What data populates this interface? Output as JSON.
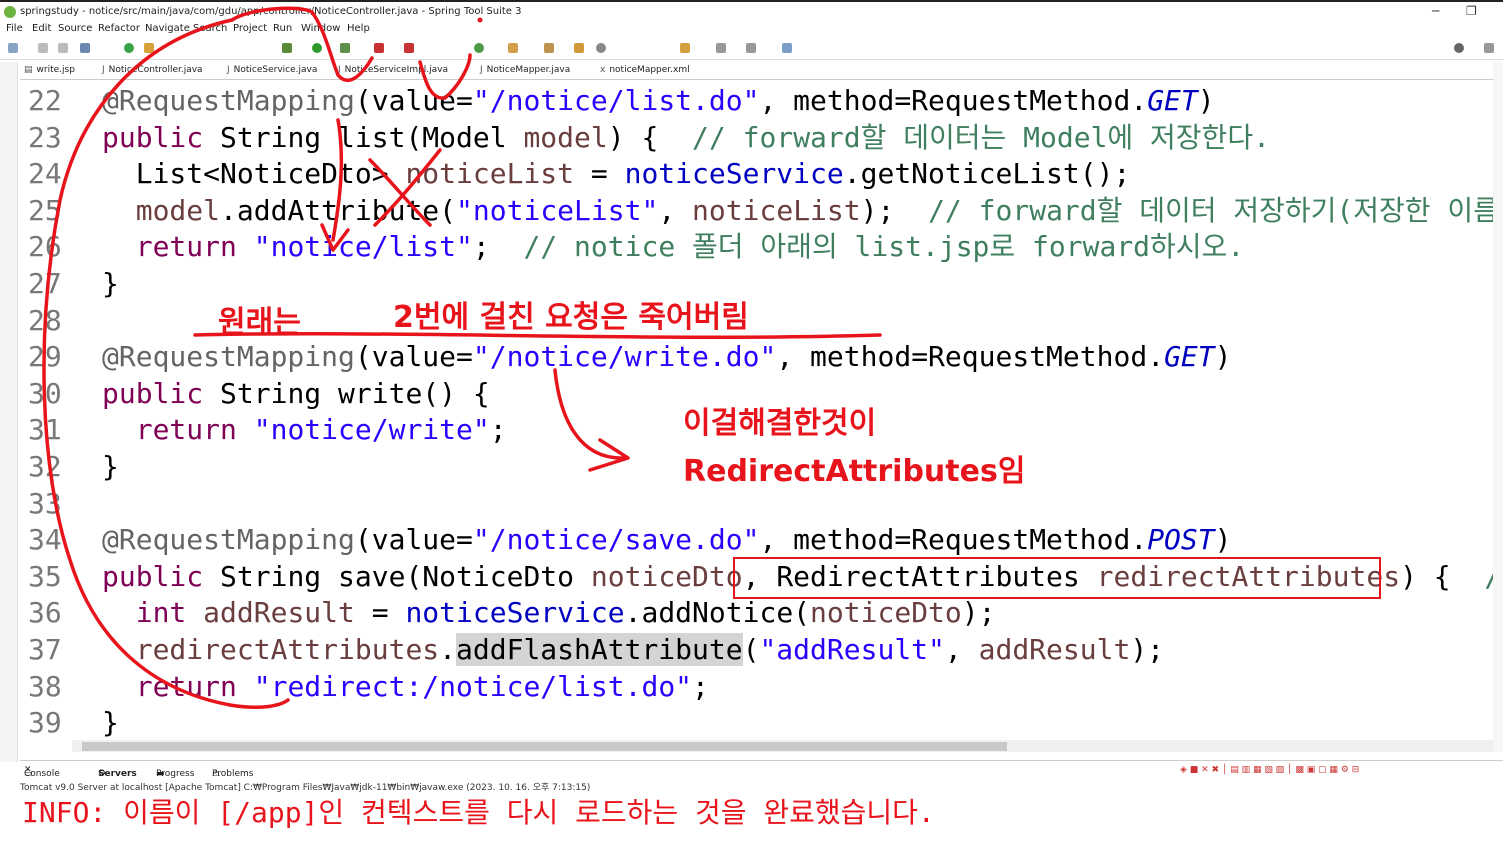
{
  "window": {
    "title": "springstudy - notice/src/main/java/com/gdu/app/controller/NoticeController.java - Spring Tool Suite 3",
    "minimize": "─",
    "restore": "❐"
  },
  "menu": [
    "File",
    "Edit",
    "Source",
    "Refactor",
    "Navigate",
    "Search",
    "Project",
    "Run",
    "Window",
    "Help"
  ],
  "tabs": [
    "write.jsp",
    "NoticeController.java",
    "NoticeService.java",
    "NoticeServiceImpl.java",
    "NoticeMapper.java",
    "noticeMapper.xml"
  ],
  "code": {
    "lines": [
      {
        "n": "22",
        "t": [
          [
            "ann",
            "@RequestMapping"
          ],
          [
            "p",
            "("
          ],
          [
            "p",
            "value="
          ],
          [
            "str",
            "\"/notice/list.do\""
          ],
          [
            "p",
            ", method=RequestMethod."
          ],
          [
            "it",
            "GET"
          ],
          [
            "p",
            ")"
          ]
        ]
      },
      {
        "n": "23",
        "t": [
          [
            "kw",
            "public"
          ],
          [
            "p",
            " String list(Model "
          ],
          [
            "par",
            "model"
          ],
          [
            "p",
            ") {  "
          ],
          [
            "cm",
            "// forward할 데이터는 Model에 저장한다."
          ]
        ]
      },
      {
        "n": "24",
        "t": [
          [
            "p",
            "  List<NoticeDto> "
          ],
          [
            "par",
            "noticeList"
          ],
          [
            "p",
            " = "
          ],
          [
            "fld",
            "noticeService"
          ],
          [
            "p",
            ".getNoticeList();"
          ]
        ]
      },
      {
        "n": "25",
        "t": [
          [
            "p",
            "  "
          ],
          [
            "par",
            "model"
          ],
          [
            "p",
            ".addAttribute("
          ],
          [
            "str",
            "\"noticeList\""
          ],
          [
            "p",
            ", "
          ],
          [
            "par",
            "noticeList"
          ],
          [
            "p",
            ");  "
          ],
          [
            "cm",
            "// forward할 데이터 저장하기(저장한 이름"
          ]
        ]
      },
      {
        "n": "26",
        "t": [
          [
            "p",
            "  "
          ],
          [
            "kw",
            "return"
          ],
          [
            "p",
            " "
          ],
          [
            "str",
            "\"notice/list\""
          ],
          [
            "p",
            ";  "
          ],
          [
            "cm",
            "// notice 폴더 아래의 list.jsp로 forward하시오."
          ]
        ]
      },
      {
        "n": "27",
        "t": [
          [
            "p",
            "}"
          ]
        ]
      },
      {
        "n": "28",
        "t": []
      },
      {
        "n": "29",
        "t": [
          [
            "ann",
            "@RequestMapping"
          ],
          [
            "p",
            "(value="
          ],
          [
            "str",
            "\"/notice/write.do\""
          ],
          [
            "p",
            ", method=RequestMethod."
          ],
          [
            "it",
            "GET"
          ],
          [
            "p",
            ")"
          ]
        ]
      },
      {
        "n": "30",
        "t": [
          [
            "kw",
            "public"
          ],
          [
            "p",
            " String write() {"
          ]
        ]
      },
      {
        "n": "31",
        "t": [
          [
            "p",
            "  "
          ],
          [
            "kw",
            "return"
          ],
          [
            "p",
            " "
          ],
          [
            "str",
            "\"notice/write\""
          ],
          [
            "p",
            ";"
          ]
        ]
      },
      {
        "n": "32",
        "t": [
          [
            "p",
            "}"
          ]
        ]
      },
      {
        "n": "33",
        "t": []
      },
      {
        "n": "34",
        "t": [
          [
            "ann",
            "@RequestMapping"
          ],
          [
            "p",
            "(value="
          ],
          [
            "str",
            "\"/notice/save.do\""
          ],
          [
            "p",
            ", method=RequestMethod."
          ],
          [
            "it",
            "POST"
          ],
          [
            "p",
            ")"
          ]
        ]
      },
      {
        "n": "35",
        "t": [
          [
            "kw",
            "public"
          ],
          [
            "p",
            " String save(NoticeDto "
          ],
          [
            "par",
            "noticeDto"
          ],
          [
            "p",
            ", RedirectAttributes "
          ],
          [
            "par",
            "redirectAttributes"
          ],
          [
            "p",
            ") {  "
          ],
          [
            "cm",
            "// red"
          ]
        ]
      },
      {
        "n": "36",
        "t": [
          [
            "p",
            "  "
          ],
          [
            "kw",
            "int"
          ],
          [
            "p",
            " "
          ],
          [
            "par",
            "addResult"
          ],
          [
            "p",
            " = "
          ],
          [
            "fld",
            "noticeService"
          ],
          [
            "p",
            ".addNotice("
          ],
          [
            "par",
            "noticeDto"
          ],
          [
            "p",
            ");"
          ]
        ]
      },
      {
        "n": "37",
        "t": [
          [
            "p",
            "  "
          ],
          [
            "par",
            "redirectAttributes"
          ],
          [
            "p",
            "."
          ],
          [
            "hl",
            "addFlashAttribute"
          ],
          [
            "p",
            "("
          ],
          [
            "str",
            "\"addResult\""
          ],
          [
            "p",
            ", "
          ],
          [
            "par",
            "addResult"
          ],
          [
            "p",
            ");"
          ]
        ]
      },
      {
        "n": "38",
        "t": [
          [
            "p",
            "  "
          ],
          [
            "kw",
            "return"
          ],
          [
            "p",
            " "
          ],
          [
            "str",
            "\"redirect:/notice/list.do\""
          ],
          [
            "p",
            ";"
          ]
        ]
      },
      {
        "n": "39",
        "t": [
          [
            "p",
            "}"
          ]
        ]
      }
    ]
  },
  "annotations": {
    "originally": "원래는",
    "dies": "2번에 걸친 요청은 죽어버림",
    "solved1": "이걸해결한것이",
    "solved2": "RedirectAttributes임"
  },
  "console": {
    "tabs": [
      "Console",
      "Servers",
      "Progress",
      "Problems"
    ],
    "info": "Tomcat v9.0 Server at localhost [Apache Tomcat] C:₩Program Files₩Java₩jdk-11₩bin₩javaw.exe  (2023. 10. 16. 오후 7:13:15)",
    "message": "INFO: 이름이 [/app]인 컨텍스트를 다시 로드하는 것을 완료했습니다."
  },
  "colors": {
    "annotation_red": "#e8141c",
    "keyword": "#7f0055",
    "string": "#2a00ff",
    "comment": "#3f7f5f"
  }
}
